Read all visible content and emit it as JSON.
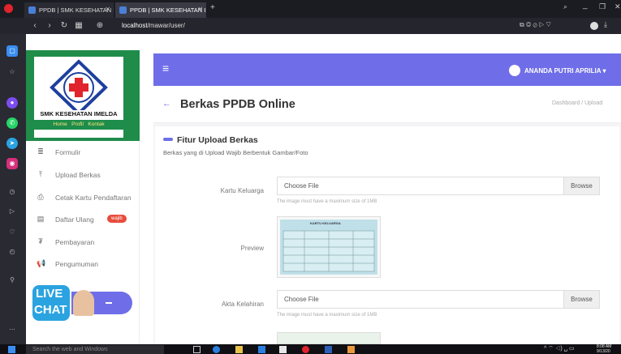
{
  "browser": {
    "tabs": [
      {
        "label": "PPDB | SMK KESEHATAN IM"
      },
      {
        "label": "PPDB | SMK KESEHATAN IM"
      }
    ],
    "new_tab": "+",
    "url_host": "localhost",
    "url_path": "/mawar/user/"
  },
  "sidebar": {
    "logo_text": "SMK KESEHATAN IMELDA",
    "logo_links": [
      "Home",
      "Profil",
      "Kontak"
    ],
    "items": [
      {
        "label": "Formulir",
        "icon": "list-icon"
      },
      {
        "label": "Upload Berkas",
        "icon": "upload-icon"
      },
      {
        "label": "Cetak Kartu Pendaftaran",
        "icon": "print-icon"
      },
      {
        "label": "Daftar Ulang",
        "icon": "table-icon",
        "badge": "wajib"
      },
      {
        "label": "Pembayaran",
        "icon": "money-icon"
      },
      {
        "label": "Pengumuman",
        "icon": "megaphone-icon"
      }
    ],
    "livechat": {
      "line1": "LIVE",
      "line2": "CHAT"
    }
  },
  "header": {
    "user_name": "ANANDA PUTRI APRILIA"
  },
  "page": {
    "title": "Berkas PPDB Online",
    "breadcrumb": "Dashboard / Upload"
  },
  "card": {
    "title": "Fitur Upload Berkas",
    "description": "Berkas yang di Upload Wajib Berbentuk Gambar/Foto"
  },
  "form": {
    "kk_label": "Kartu Keluarga",
    "kk_choose": "Choose File",
    "kk_browse": "Browse",
    "kk_helper": "The image must have a maximum size of 1MB",
    "preview_label": "Preview",
    "preview_doc_title": "KARTU KELUARGA",
    "akta_label": "Akta Kelahiran",
    "akta_choose": "Choose File",
    "akta_browse": "Browse",
    "akta_helper": "The image must have a maximum size of 1MB"
  },
  "taskbar": {
    "search_placeholder": "Search the web and Windows",
    "time": "8:08 AM",
    "date": "9/13/20"
  },
  "colors": {
    "accent": "#6f6ee8",
    "badge": "#e74c3c",
    "logo_green": "#1f8c4a"
  }
}
